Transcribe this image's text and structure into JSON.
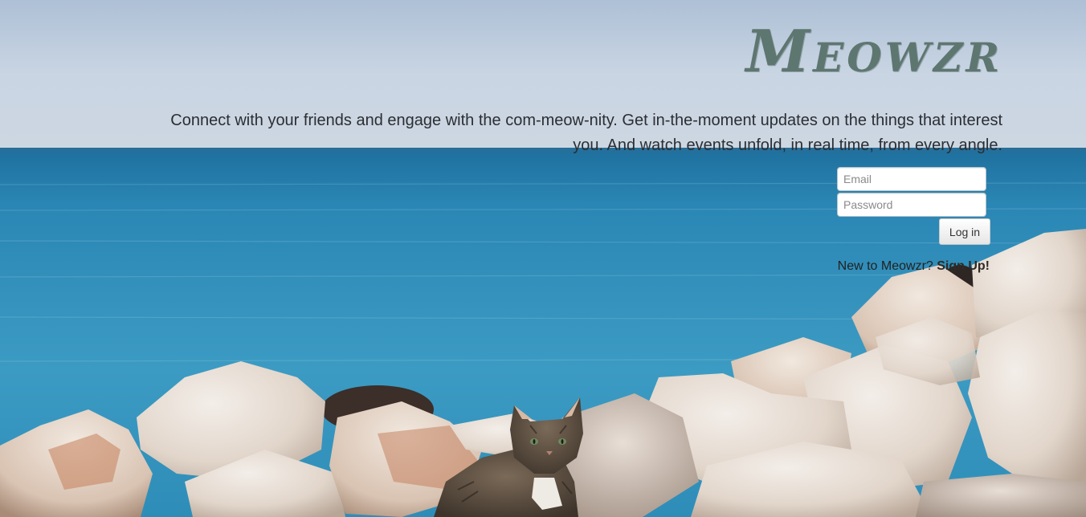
{
  "brand": {
    "name": "Meowzr"
  },
  "hero": {
    "tagline_line1": "Connect with your friends and engage with the com-meow-nity. Get in-the-moment updates on the things that interest",
    "tagline_line2": "you. And watch events unfold, in real time, from every angle."
  },
  "login": {
    "email_placeholder": "Email",
    "password_placeholder": "Password",
    "submit_label": "Log in"
  },
  "signup": {
    "prompt": "New to Meowzr? ",
    "link_label": "Sign Up!"
  },
  "background": {
    "scene": "cat-on-rocks-by-sea-photo",
    "colors": {
      "sky": "#c8d4e2",
      "sea": "#2a86b0",
      "rock": "#e6ddd3",
      "brand_text": "#5e7670"
    }
  }
}
